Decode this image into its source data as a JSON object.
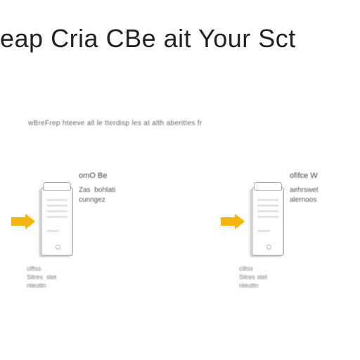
{
  "title": "eap Cria CBe ait Your Sct",
  "subtitle": "wBreFrep  hteeve  all  le tterdisp  les  at   alth aberittes  fr",
  "blocks": {
    "left": {
      "caption_top": "omO Be",
      "caption_lines": "Zas  bohtati\ncunngez",
      "footer": "ciftss\nSitres  stet\nnteuttn"
    },
    "right": {
      "caption_top": "ofifce  W",
      "caption_lines": "aehrswet\nalernoos",
      "footer": "ciltss\nSitres stet\nnteuttn"
    }
  }
}
